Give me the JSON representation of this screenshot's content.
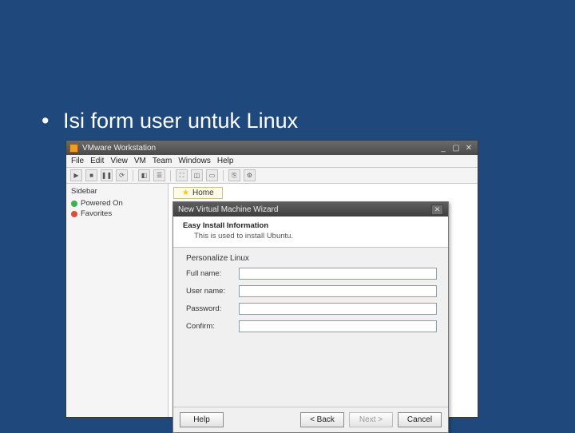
{
  "slide": {
    "bullet": "Isi form user untuk Linux"
  },
  "titlebar": {
    "app_name": "VMware Workstation",
    "min": "_",
    "max": "▢",
    "close": "✕"
  },
  "menubar": [
    "File",
    "Edit",
    "View",
    "VM",
    "Team",
    "Windows",
    "Help"
  ],
  "sidebar": {
    "header": "Sidebar",
    "items": [
      {
        "label": "Powered On"
      },
      {
        "label": "Favorites"
      }
    ]
  },
  "tab": {
    "label": "Home"
  },
  "wizard": {
    "title": "New Virtual Machine Wizard",
    "close": "✕",
    "header_title": "Easy Install Information",
    "header_subtitle": "This is used to install Ubuntu.",
    "section_label": "Personalize Linux",
    "fields": {
      "full_name_label": "Full name:",
      "user_name_label": "User name:",
      "password_label": "Password:",
      "confirm_label": "Confirm:",
      "full_name_value": "",
      "user_name_value": "",
      "password_value": "",
      "confirm_value": ""
    },
    "buttons": {
      "help": "Help",
      "back": "< Back",
      "next": "Next >",
      "cancel": "Cancel"
    }
  }
}
